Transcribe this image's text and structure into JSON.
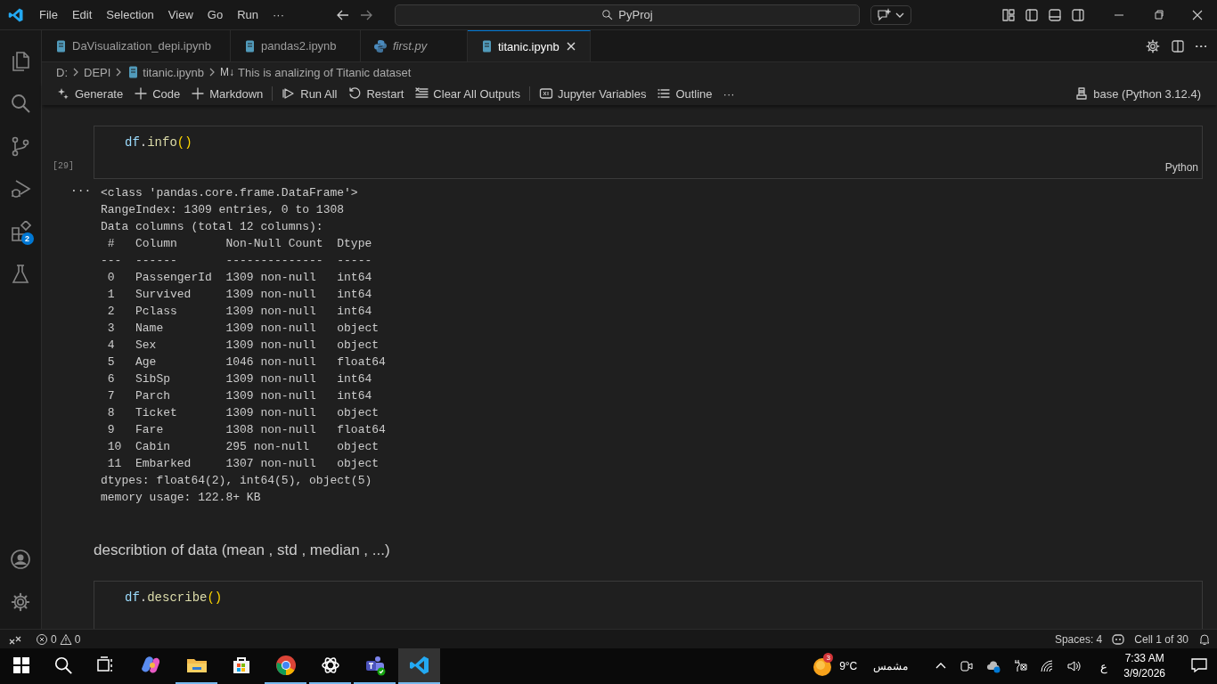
{
  "title_bar": {
    "menu": [
      "File",
      "Edit",
      "Selection",
      "View",
      "Go",
      "Run",
      "···"
    ],
    "search": "PyProj"
  },
  "tabs": [
    {
      "label": "DaVisualization_depi.ipynb",
      "kind": "notebook",
      "preview": false,
      "selected": false
    },
    {
      "label": "pandas2.ipynb",
      "kind": "notebook",
      "preview": false,
      "selected": false
    },
    {
      "label": "first.py",
      "kind": "python",
      "preview": true,
      "selected": false
    },
    {
      "label": "titanic.ipynb",
      "kind": "notebook",
      "preview": false,
      "selected": true
    }
  ],
  "breadcrumb": [
    {
      "kind": "plain",
      "label": "D:"
    },
    {
      "kind": "plain",
      "label": "DEPI"
    },
    {
      "kind": "notebook",
      "label": "titanic.ipynb"
    },
    {
      "kind": "markdown",
      "icon_text": "M↓",
      "label": "This is analizing of Titanic dataset"
    }
  ],
  "toolbar": [
    {
      "kind": "sparkle",
      "label": "Generate"
    },
    {
      "kind": "plus",
      "label": "Code"
    },
    {
      "kind": "plus",
      "label": "Markdown"
    },
    {
      "kind": "separator"
    },
    {
      "kind": "run",
      "label": "Run All"
    },
    {
      "kind": "restart",
      "label": "Restart"
    },
    {
      "kind": "clear",
      "label": "Clear All Outputs"
    },
    {
      "kind": "separator"
    },
    {
      "kind": "variables",
      "label": "Jupyter Variables"
    },
    {
      "kind": "outline",
      "label": "Outline"
    },
    {
      "kind": "more",
      "label": "···"
    }
  ],
  "kernel": "base (Python 3.12.4)",
  "activity_bar": [
    {
      "kind": "files"
    },
    {
      "kind": "search"
    },
    {
      "kind": "branch"
    },
    {
      "kind": "debug"
    },
    {
      "kind": "extensions",
      "badge": "2"
    },
    {
      "kind": "flask"
    }
  ],
  "cells": [
    {
      "kind": "code",
      "exec_count": "[29]",
      "language": "Python",
      "code": [
        {
          "kind": "variable",
          "text": "df"
        },
        {
          "kind": "plain",
          "text": "."
        },
        {
          "kind": "function",
          "text": "info"
        },
        {
          "kind": "bracket",
          "text": "()"
        }
      ],
      "output_marker": "···",
      "output": [
        "<class 'pandas.core.frame.DataFrame'>",
        "RangeIndex: 1309 entries, 0 to 1308",
        "Data columns (total 12 columns):",
        " #   Column       Non-Null Count  Dtype  ",
        "---  ------       --------------  -----  ",
        " 0   PassengerId  1309 non-null   int64  ",
        " 1   Survived     1309 non-null   int64  ",
        " 2   Pclass       1309 non-null   int64  ",
        " 3   Name         1309 non-null   object ",
        " 4   Sex          1309 non-null   object ",
        " 5   Age          1046 non-null   float64",
        " 6   SibSp        1309 non-null   int64  ",
        " 7   Parch        1309 non-null   int64  ",
        " 8   Ticket       1309 non-null   object ",
        " 9   Fare         1308 non-null   float64",
        " 10  Cabin        295 non-null    object ",
        " 11  Embarked     1307 non-null   object ",
        "dtypes: float64(2), int64(5), object(5)",
        "memory usage: 122.8+ KB"
      ]
    },
    {
      "kind": "markdown",
      "text": "describtion of data (mean , std , median , ...)"
    },
    {
      "kind": "code",
      "code": [
        {
          "kind": "variable",
          "text": "df"
        },
        {
          "kind": "plain",
          "text": "."
        },
        {
          "kind": "function",
          "text": "describe"
        },
        {
          "kind": "bracket",
          "text": "()"
        }
      ]
    }
  ],
  "status_bar": {
    "errors": "0",
    "warnings": "0",
    "indentation": "Spaces: 4",
    "cell_position": "Cell 1 of 30"
  },
  "taskbar": {
    "apps": [
      {
        "kind": "copilot",
        "running": false,
        "active": false
      },
      {
        "kind": "folder",
        "running": true,
        "active": false
      },
      {
        "kind": "store",
        "running": false,
        "active": false
      },
      {
        "kind": "browser",
        "running": true,
        "active": false
      },
      {
        "kind": "knot",
        "running": true,
        "active": false
      },
      {
        "kind": "people",
        "running": true,
        "active": false
      },
      {
        "kind": "editor",
        "running": true,
        "active": true
      }
    ],
    "weather_badge": "3",
    "temperature": "9°C",
    "weather": "مشمس",
    "language": "ع",
    "time": "7:33 AM",
    "date": "3/9/2026"
  }
}
